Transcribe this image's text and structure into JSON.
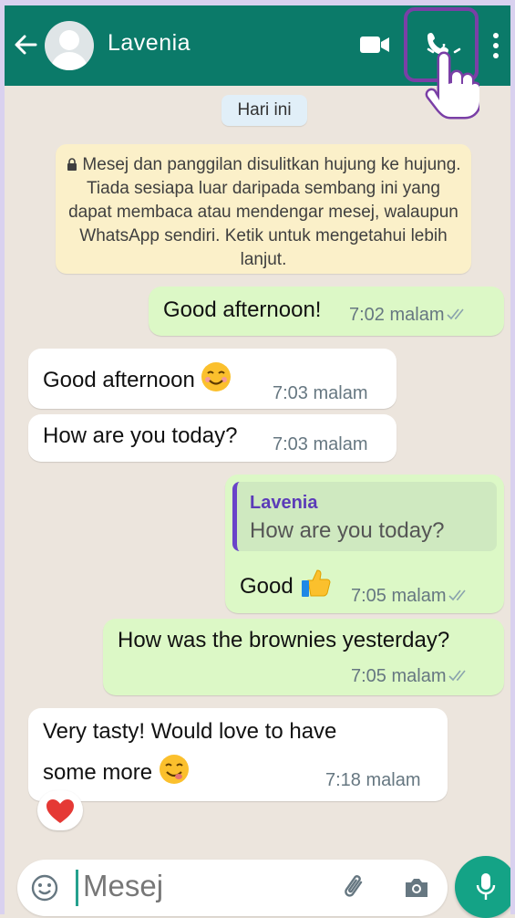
{
  "header": {
    "contact_name": "Lavenia",
    "icons": [
      "back-arrow-icon",
      "avatar-icon",
      "video-call-icon",
      "voice-call-icon",
      "more-options-icon",
      "hand-pointer-icon"
    ],
    "colors": {
      "header_bg": "#0b7a69",
      "highlight": "#7a3fa6"
    }
  },
  "chat": {
    "date_chip": "Hari ini",
    "encryption_notice": "Mesej dan panggilan disulitkan hujung ke hujung. Tiada sesiapa luar daripada sembang ini yang dapat membaca atau mendengar mesej, walaupun WhatsApp sendiri. Ketik untuk mengetahui lebih lanjut.",
    "messages": [
      {
        "dir": "out",
        "text": "Good afternoon!",
        "time": "7:02 malam",
        "status": "read"
      },
      {
        "dir": "in",
        "text": "Good afternoon",
        "emoji": "smiling-face",
        "time": "7:03 malam"
      },
      {
        "dir": "in",
        "text": "How are you today?",
        "time": "7:03 malam"
      },
      {
        "dir": "out",
        "quote_name": "Lavenia",
        "quote_text": "How are you today?",
        "text": "Good",
        "emoji": "thumbs-up",
        "time": "7:05 malam",
        "status": "read"
      },
      {
        "dir": "out",
        "text": "How was the brownies yesterday?",
        "time": "7:05 malam",
        "status": "read"
      },
      {
        "dir": "in",
        "text_line1": "Very tasty! Would love to have",
        "text_line2": "some more",
        "emoji": "yum-face",
        "time": "7:18 malam",
        "reaction": "red-heart"
      }
    ]
  },
  "input": {
    "placeholder": "Mesej",
    "icons": [
      "emoji-icon",
      "attach-icon",
      "camera-icon",
      "mic-icon"
    ]
  }
}
